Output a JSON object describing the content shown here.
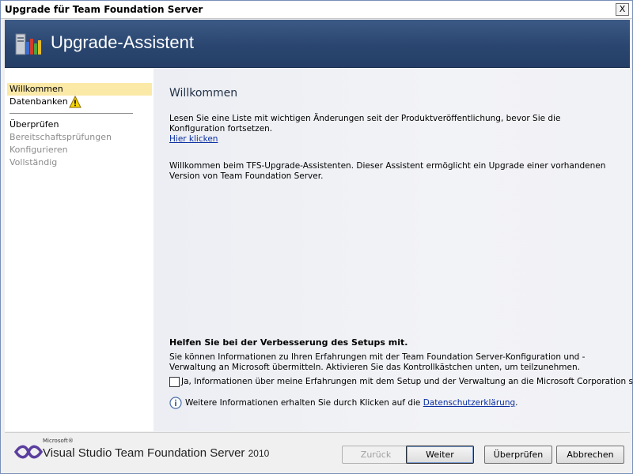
{
  "window": {
    "title": "Upgrade für Team Foundation Server",
    "close_label": "X"
  },
  "banner": {
    "heading": "Upgrade-Assistent"
  },
  "sidebar": {
    "items": [
      {
        "label": "Willkommen"
      },
      {
        "label": "Datenbanken"
      },
      {
        "label": "Überprüfen"
      },
      {
        "label": "Bereitschaftsprüfungen"
      },
      {
        "label": "Konfigurieren"
      },
      {
        "label": "Vollständig"
      }
    ]
  },
  "content": {
    "heading": "Willkommen",
    "intro": "Lesen Sie eine Liste mit wichtigen Änderungen seit der Produktveröffentlichung, bevor Sie die Konfiguration fortsetzen.",
    "intro_link": "Hier klicken",
    "welcome": "Willkommen beim TFS-Upgrade-Assistenten. Dieser Assistent ermöglicht ein Upgrade einer vorhandenen Version von Team Foundation Server.",
    "improve_heading": "Helfen Sie bei der Verbesserung des Setups mit.",
    "improve_text": "Sie können Informationen zu Ihren Erfahrungen mit der Team Foundation Server-Konfiguration und -Verwaltung an Microsoft übermitteln. Aktivieren Sie das Kontrollkästchen unten, um teilzunehmen.",
    "checkbox_label": "Ja, Informationen über meine Erfahrungen mit dem Setup und der Verwaltung an die Microsoft Corporation senden",
    "info_text": "Weitere Informationen erhalten Sie durch Klicken auf die",
    "info_link": "Datenschutzerklärung",
    "info_end": "."
  },
  "footer": {
    "brand_small": "Microsoft®",
    "brand": "Visual Studio Team Foundation Server",
    "brand_year": "2010",
    "buttons": {
      "back": "Zurück",
      "next": "Weiter",
      "review": "Überprüfen",
      "cancel": "Abbrechen"
    }
  }
}
